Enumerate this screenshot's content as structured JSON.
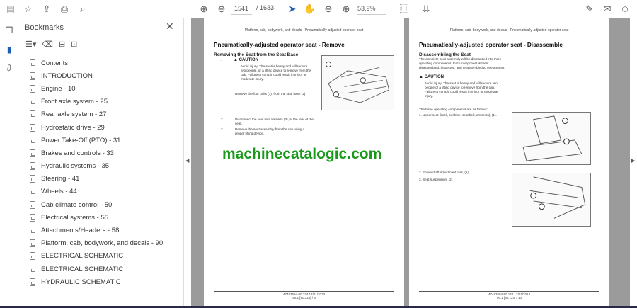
{
  "toolbar": {
    "page_current": "1541",
    "page_total": "/ 1633",
    "zoom": "53,9%"
  },
  "bookmarks": {
    "title": "Bookmarks",
    "items": [
      "Contents",
      "INTRODUCTION",
      "Engine - 10",
      "Front axle system - 25",
      "Rear axle system - 27",
      "Hydrostatic drive - 29",
      "Power Take-Off (PTO) - 31",
      "Brakes and controls - 33",
      "Hydraulic systems - 35",
      "Steering - 41",
      "Wheels - 44",
      "Cab climate control - 50",
      "Electrical systems - 55",
      "Attachments/Headers - 58",
      "Platform, cab, bodywork, and decals - 90",
      "ELECTRICAL SCHEMATIC",
      "ELECTRICAL SCHEMATIC",
      "HYDRAULIC SCHEMATIC"
    ]
  },
  "page_left": {
    "header": "Platform, cab, bodywork, and decals - Pneumatically-adjusted operator seat",
    "title": "Pneumatically-adjusted operator seat - Remove",
    "subtitle": "Removing the Seat from the Seat Base",
    "step1_num": "1.",
    "caution": "CAUTION",
    "caution_text": "Avoid injury! The seat is heavy and will require two people, or a lifting device to remove from the cab. Failure to comply could result in minor or moderate injury.",
    "step1_text": "Remove the four bolts (1), from the seat base (2).",
    "step2_num": "2.",
    "step2_text": "Disconnect the seat wire harness (3), at the rear of the seat.",
    "step3_num": "3.",
    "step3_text": "Remove the seat assembly from the cab using a proper lifting device.",
    "footer1": "47487694-80 124 17/01/2013",
    "footer2": "90.1 [90.124] / 9"
  },
  "page_right": {
    "header": "Platform, cab, bodywork, and decals - Pneumatically-adjusted operator seat",
    "title": "Pneumatically-adjusted operator seat - Disassemble",
    "subtitle": "Disassembling the Seat",
    "intro": "The complete seat assembly will be dismantled into three operating components. Each component is then disassembled, inspected, and re-assembled to one another.",
    "caution": "CAUTION",
    "caution_text": "Avoid injury! The seat is heavy and will require two people or a lifting device to remove from the cab. Failure to comply could result in minor or moderate injury.",
    "list_intro": "The three operating components are as follows:",
    "step1": "1.     Upper seat (back, cushion, seat belt, armrests), (1).",
    "step2": "2.     Forward/aft adjustment rails, (1).",
    "step3": "3.     Seat suspension, (2).",
    "footer1": "47487694-80 124 17/01/2013",
    "footer2": "90.1 [90.124] / 10"
  },
  "watermark": "machinecatalogic.com"
}
